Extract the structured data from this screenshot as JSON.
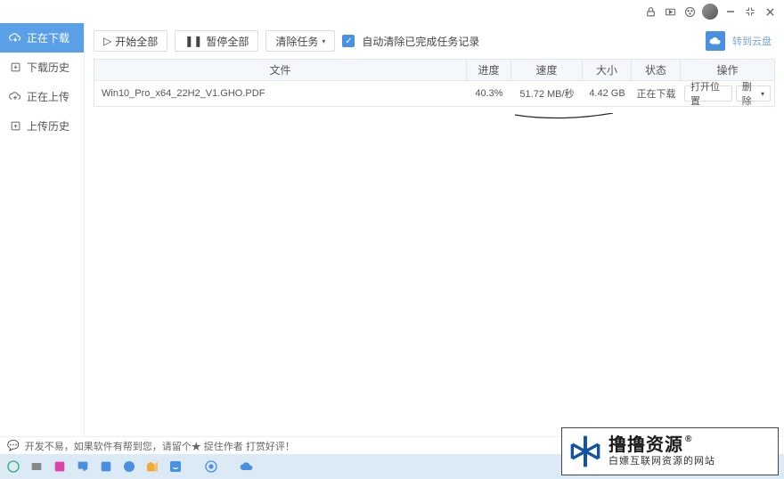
{
  "titlebar": {
    "icons": {
      "lock": "lock",
      "video": "video",
      "skin": "skin",
      "avatar": "avatar",
      "min": "minimize",
      "restore": "restore",
      "close": "close"
    }
  },
  "sidebar": {
    "items": [
      {
        "icon": "cloud-down",
        "label": "正在下载"
      },
      {
        "icon": "list-down",
        "label": "下载历史"
      },
      {
        "icon": "cloud-up",
        "label": "正在上传"
      },
      {
        "icon": "list-up",
        "label": "上传历史"
      }
    ]
  },
  "toolbar": {
    "start_all": "开始全部",
    "pause_all": "暂停全部",
    "clear_tasks": "清除任务",
    "auto_clear": "自动清除已完成任务记录",
    "cloud_back": "转到云盘"
  },
  "table": {
    "headers": {
      "file": "文件",
      "progress": "进度",
      "speed": "速度",
      "size": "大小",
      "status": "状态",
      "ops": "操作"
    },
    "rows": [
      {
        "file": "Win10_Pro_x64_22H2_V1.GHO.PDF",
        "progress": "40.3%",
        "speed": "51.72 MB/秒",
        "size": "4.42 GB",
        "status": "正在下载",
        "op1": "打开位置",
        "op2": "删除"
      }
    ]
  },
  "statusbar": {
    "text": "开发不易，如果软件有帮到您，请留个★  捉住作者  打赏好评！"
  },
  "watermark": {
    "big": "撸撸资源",
    "small": "白嫖互联网资源的网站"
  },
  "colors": {
    "accent": "#4a90e2"
  }
}
